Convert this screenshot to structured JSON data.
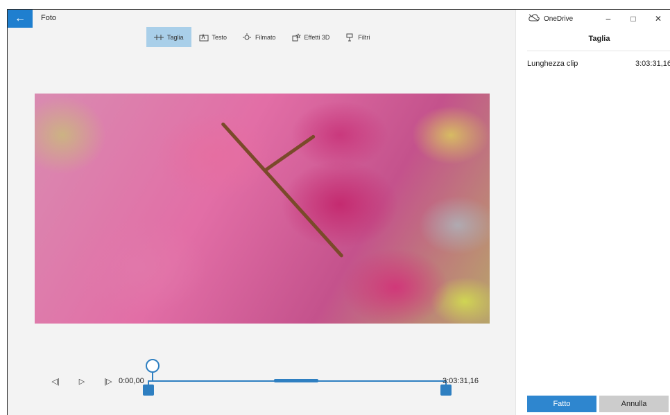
{
  "app": {
    "back_icon": "arrow-left-icon",
    "title": "Foto"
  },
  "toolbar": {
    "tools": [
      {
        "label": "Taglia",
        "icon": "trim-icon",
        "active": true
      },
      {
        "label": "Testo",
        "icon": "text-icon",
        "active": false
      },
      {
        "label": "Filmato",
        "icon": "motion-icon",
        "active": false
      },
      {
        "label": "Effetti 3D",
        "icon": "effects-3d-icon",
        "active": false
      },
      {
        "label": "Filtri",
        "icon": "filters-icon",
        "active": false
      }
    ]
  },
  "playback": {
    "start_time": "0:00,00",
    "end_time": "3:03:31,16",
    "playhead_fraction": 0
  },
  "window": {
    "service": "OneDrive",
    "service_icon": "onedrive-cloud-icon"
  },
  "panel": {
    "title": "Taglia",
    "clip_length_label": "Lunghezza clip",
    "clip_length_value": "3:03:31,16",
    "done_label": "Fatto",
    "cancel_label": "Annulla"
  },
  "colors": {
    "accent": "#2e7fc1",
    "toolbar_active": "#a9cfe9",
    "back_button": "#1f7fcf"
  }
}
